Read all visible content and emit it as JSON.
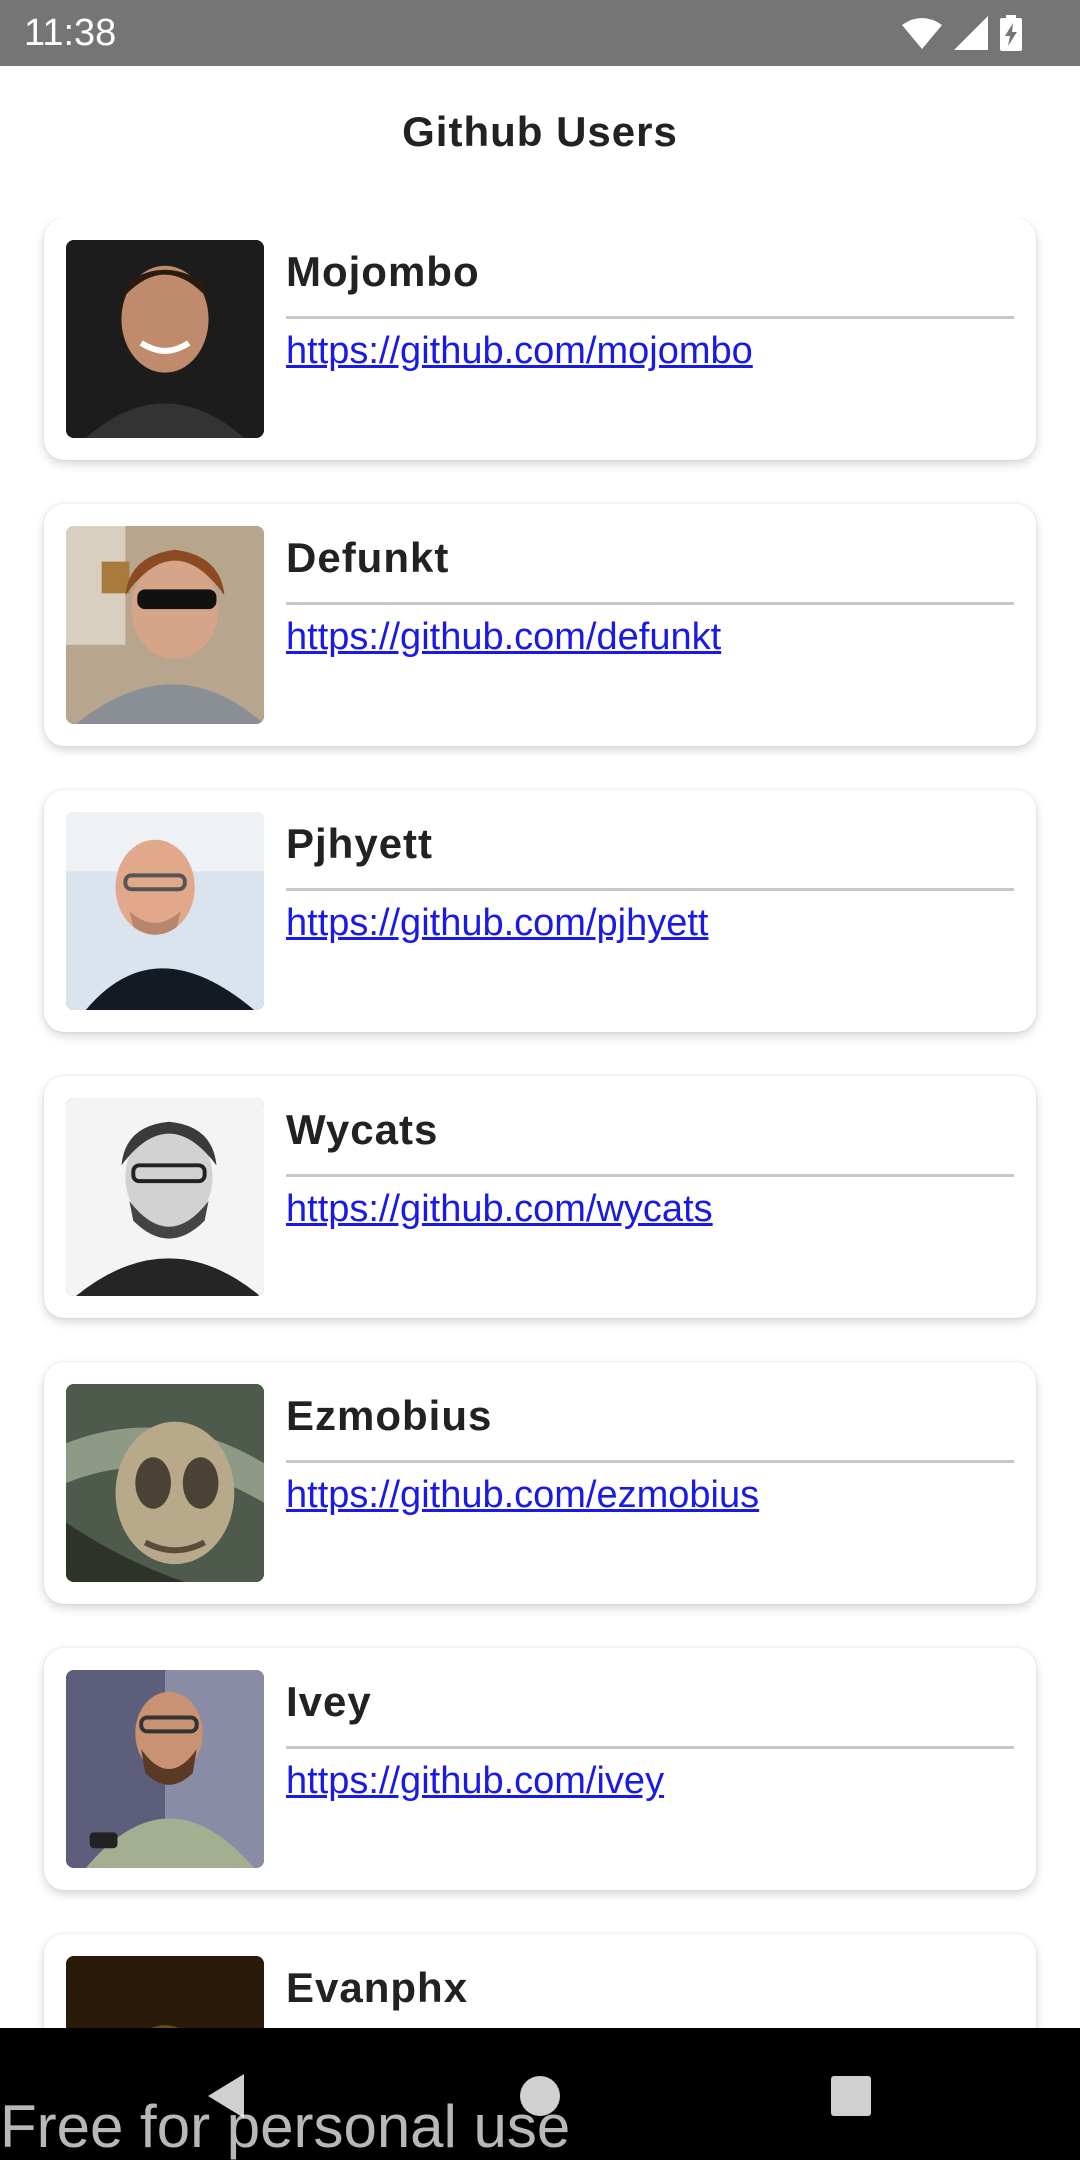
{
  "status_bar": {
    "time": "11:38"
  },
  "app": {
    "title": "Github Users"
  },
  "users": [
    {
      "name": "Mojombo",
      "url": "https://github.com/mojombo"
    },
    {
      "name": "Defunkt",
      "url": "https://github.com/defunkt"
    },
    {
      "name": "Pjhyett",
      "url": "https://github.com/pjhyett"
    },
    {
      "name": "Wycats",
      "url": "https://github.com/wycats"
    },
    {
      "name": "Ezmobius",
      "url": "https://github.com/ezmobius"
    },
    {
      "name": "Ivey",
      "url": "https://github.com/ivey"
    },
    {
      "name": "Evanphx",
      "url": ""
    }
  ],
  "watermark": "Free for personal use",
  "colors": {
    "status_bar": "#757575",
    "link": "#1a1ae6",
    "nav_bar": "#000000"
  }
}
